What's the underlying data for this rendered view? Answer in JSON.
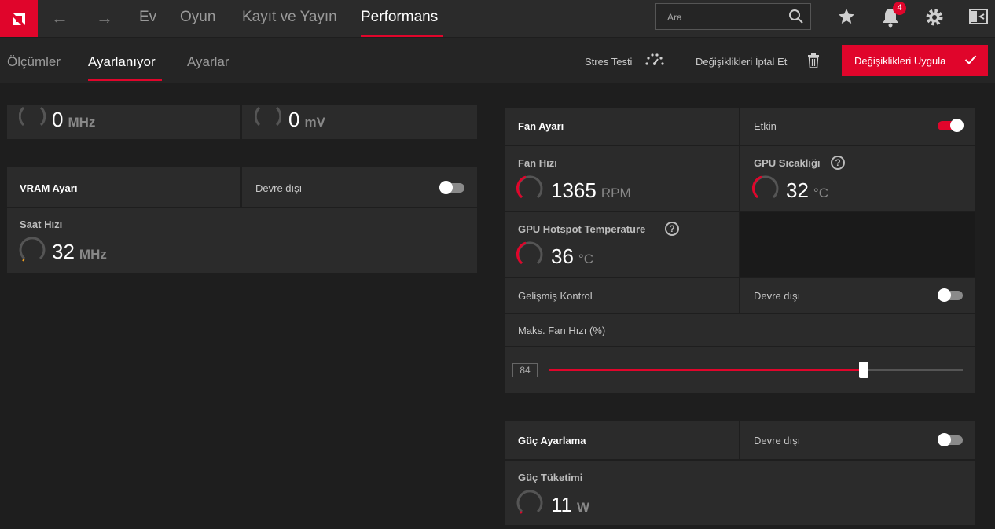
{
  "top_nav": {
    "links": [
      "Ev",
      "Oyun",
      "Kayıt ve Yayın",
      "Performans"
    ],
    "search_placeholder": "Ara",
    "notification_count": "4"
  },
  "sub_nav": {
    "tabs": [
      "Ölçümler",
      "Ayarlanıyor",
      "Ayarlar"
    ],
    "stress_test": "Stres Testi",
    "discard": "Değişiklikleri İptal Et",
    "apply": "Değişiklikleri Uygula"
  },
  "gpu_top_partial": {
    "clock_value": "0",
    "clock_unit": "MHz",
    "voltage_value": "0",
    "voltage_unit": "mV"
  },
  "vram": {
    "title": "VRAM Ayarı",
    "status": "Devre dışı",
    "enabled": false,
    "clock_label": "Saat Hızı",
    "clock_value": "32",
    "clock_unit": "MHz"
  },
  "fan": {
    "title": "Fan Ayarı",
    "status": "Etkin",
    "enabled": true,
    "speed_label": "Fan Hızı",
    "speed_value": "1365",
    "speed_unit": "RPM",
    "gpu_temp_label": "GPU Sıcaklığı",
    "gpu_temp_value": "32",
    "gpu_temp_unit": "°C",
    "hotspot_label": "GPU Hotspot Temperature",
    "hotspot_value": "36",
    "hotspot_unit": "°C",
    "advanced_label": "Gelişmiş Kontrol",
    "advanced_status": "Devre dışı",
    "advanced_enabled": false,
    "max_speed_label": "Maks. Fan Hızı (%)",
    "max_speed_value": "84",
    "max_speed_fraction": 0.76
  },
  "power": {
    "title": "Güç Ayarlama",
    "status": "Devre dışı",
    "enabled": false,
    "consumption_label": "Güç Tüketimi",
    "consumption_value": "11",
    "consumption_unit": "W"
  },
  "colors": {
    "accent": "#e0052b",
    "background": "#1e1e1e",
    "card": "#2b2b2b"
  }
}
